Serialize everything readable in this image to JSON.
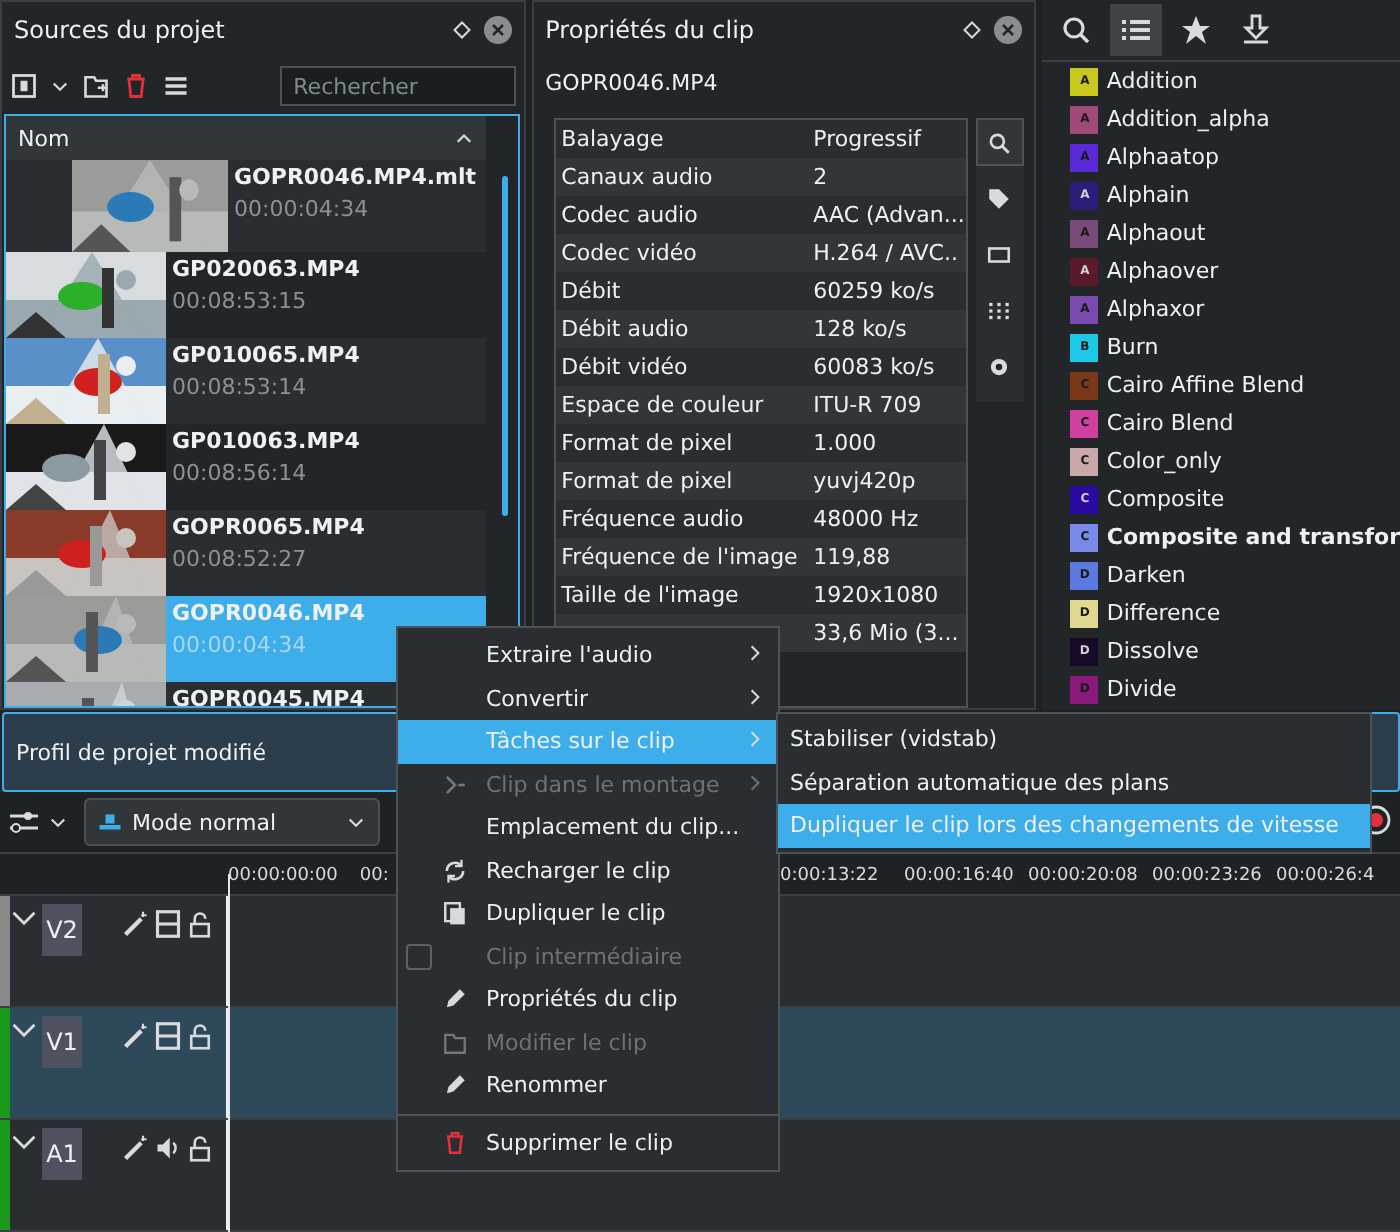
{
  "sources": {
    "title": "Sources du projet",
    "search": {
      "placeholder": "Rechercher"
    },
    "column": "Nom",
    "clips": [
      {
        "kind": "subclip",
        "name": "GOPR0046.MP4.mlt",
        "duration": "00:00:04:34",
        "selected": false
      },
      {
        "kind": "clip",
        "name": "GP020063.MP4",
        "duration": "00:08:53:15",
        "selected": false
      },
      {
        "kind": "clip",
        "name": "GP010065.MP4",
        "duration": "00:08:53:14",
        "selected": false
      },
      {
        "kind": "clip",
        "name": "GP010063.MP4",
        "duration": "00:08:56:14",
        "selected": false
      },
      {
        "kind": "clip",
        "name": "GOPR0065.MP4",
        "duration": "00:08:52:27",
        "selected": false
      },
      {
        "kind": "clip",
        "name": "GOPR0046.MP4",
        "duration": "00:00:04:34",
        "selected": true
      },
      {
        "kind": "clip",
        "name": "GOPR0045.MP4",
        "selected": false
      }
    ]
  },
  "properties": {
    "title": "Propriétés du clip",
    "clip": "GOPR0046.MP4",
    "rows": [
      {
        "label": "Balayage",
        "value": "Progressif"
      },
      {
        "label": "Canaux audio",
        "value": "2"
      },
      {
        "label": "Codec audio",
        "value": "AAC (Advan..."
      },
      {
        "label": "Codec vidéo",
        "value": "H.264 / AVC.."
      },
      {
        "label": "Débit",
        "value": "60259 ko/s"
      },
      {
        "label": "Débit audio",
        "value": "128 ko/s"
      },
      {
        "label": "Débit vidéo",
        "value": "60083 ko/s"
      },
      {
        "label": "Espace de couleur",
        "value": "ITU-R 709"
      },
      {
        "label": "Format de pixel",
        "value": "1.000"
      },
      {
        "label": "Format de pixel",
        "value": "yuvj420p"
      },
      {
        "label": "Fréquence audio",
        "value": "48000 Hz"
      },
      {
        "label": "Fréquence de l'image",
        "value": "119,88"
      },
      {
        "label": "Taille de l'image",
        "value": "1920x1080"
      },
      {
        "value": "33,6 Mio (3..."
      }
    ],
    "tools": [
      {
        "selected": true
      },
      {
        "selected": false
      },
      {
        "selected": false
      },
      {
        "selected": false
      },
      {
        "selected": false
      }
    ]
  },
  "effects": {
    "tabs": [
      {
        "selected": false
      },
      {
        "selected": true
      },
      {
        "selected": false
      },
      {
        "selected": false
      }
    ],
    "items": [
      {
        "badge": "A",
        "label": "Addition",
        "color": "#c8c81e",
        "emphasized": false
      },
      {
        "badge": "A",
        "label": "Addition_alpha",
        "color": "#a04a7a",
        "emphasized": false
      },
      {
        "badge": "A",
        "label": "Alphaatop",
        "color": "#5a2ad8",
        "emphasized": false
      },
      {
        "badge": "A",
        "label": "Alphain",
        "color": "#2a1e7a",
        "emphasized": false
      },
      {
        "badge": "A",
        "label": "Alphaout",
        "color": "#7a4a7a",
        "emphasized": false
      },
      {
        "badge": "A",
        "label": "Alphaover",
        "color": "#5a1a2a",
        "emphasized": false
      },
      {
        "badge": "A",
        "label": "Alphaxor",
        "color": "#7a4ab0",
        "emphasized": false
      },
      {
        "badge": "B",
        "label": "Burn",
        "color": "#1ec8e8",
        "emphasized": false
      },
      {
        "badge": "C",
        "label": "Cairo Affine Blend",
        "color": "#7a3a1a",
        "emphasized": false
      },
      {
        "badge": "C",
        "label": "Cairo Blend",
        "color": "#d040a0",
        "emphasized": false
      },
      {
        "badge": "C",
        "label": "Color_only",
        "color": "#c8a8a8",
        "emphasized": false
      },
      {
        "badge": "C",
        "label": "Composite",
        "color": "#2a0aa0",
        "emphasized": false
      },
      {
        "badge": "C",
        "label": "Composite and transfor",
        "color": "#7a8ae8",
        "emphasized": true
      },
      {
        "badge": "D",
        "label": "Darken",
        "color": "#5a7ae0",
        "emphasized": false
      },
      {
        "badge": "D",
        "label": "Difference",
        "color": "#e0d890",
        "emphasized": false
      },
      {
        "badge": "D",
        "label": "Dissolve",
        "color": "#1a0a2a",
        "emphasized": false
      },
      {
        "badge": "D",
        "label": "Divide",
        "color": "#8a1a7a",
        "emphasized": false
      }
    ]
  },
  "notification": {
    "text": "Profil de projet modifié"
  },
  "toolbar": {
    "mode": "Mode normal"
  },
  "timeline": {
    "ruler_left": [
      "00:00:00:00",
      "00:"
    ],
    "ruler_right": [
      "0:00:13:22",
      "00:00:16:40",
      "00:00:20:08",
      "00:00:23:26",
      "00:00:26:4"
    ],
    "tracks": [
      {
        "name": "V2",
        "kind": "video",
        "active": false,
        "selected": false
      },
      {
        "name": "V1",
        "kind": "video",
        "active": true,
        "selected": true
      },
      {
        "name": "A1",
        "kind": "audio",
        "active": true,
        "selected": false
      }
    ]
  },
  "context_menu": {
    "items": [
      {
        "kind": "submenu",
        "label": "Extraire l'audio",
        "selected": false,
        "disabled": false
      },
      {
        "kind": "submenu",
        "label": "Convertir",
        "selected": false,
        "disabled": false
      },
      {
        "kind": "submenu",
        "label": "Tâches sur le clip",
        "selected": true,
        "disabled": false
      },
      {
        "kind": "submenu",
        "label": "Clip dans le montage",
        "selected": false,
        "disabled": true
      },
      {
        "kind": "action",
        "label": "Emplacement du clip...",
        "selected": false,
        "disabled": false
      },
      {
        "kind": "action",
        "label": "Recharger le clip",
        "selected": false,
        "disabled": false
      },
      {
        "kind": "action",
        "label": "Dupliquer le clip",
        "selected": false,
        "disabled": false
      },
      {
        "kind": "checkbox",
        "label": "Clip intermédiaire",
        "selected": false,
        "disabled": true,
        "checked": false
      },
      {
        "kind": "action",
        "label": "Propriétés du clip",
        "selected": false,
        "disabled": false
      },
      {
        "kind": "action",
        "label": "Modifier le clip",
        "selected": false,
        "disabled": true
      },
      {
        "kind": "action",
        "label": "Renommer",
        "selected": false,
        "disabled": false
      },
      {
        "kind": "separator"
      },
      {
        "kind": "action",
        "label": "Supprimer le clip",
        "selected": false,
        "disabled": false
      }
    ]
  },
  "submenu": {
    "items": [
      {
        "label": "Stabiliser (vidstab)",
        "selected": false
      },
      {
        "label": "Séparation automatique des plans",
        "selected": false
      },
      {
        "label": "Dupliquer le clip lors des changements de vitesse",
        "selected": true
      }
    ]
  }
}
